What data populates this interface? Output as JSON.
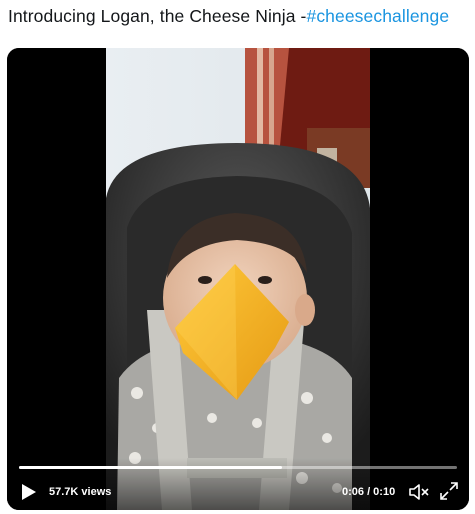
{
  "tweet": {
    "text": "Introducing Logan, the Cheese Ninja -",
    "hashtag": "#cheesechallenge"
  },
  "video": {
    "views_label": "57.7K views",
    "current_time": "0:06",
    "duration": "0:10",
    "time_display": "0:06 / 0:10",
    "progress": 0.6
  },
  "icons": {
    "play": "play-icon",
    "mute": "speaker-muted-icon",
    "fullscreen": "fullscreen-icon"
  },
  "colors": {
    "hashtag": "#1b95e0",
    "cheese": "#f2b21e"
  }
}
